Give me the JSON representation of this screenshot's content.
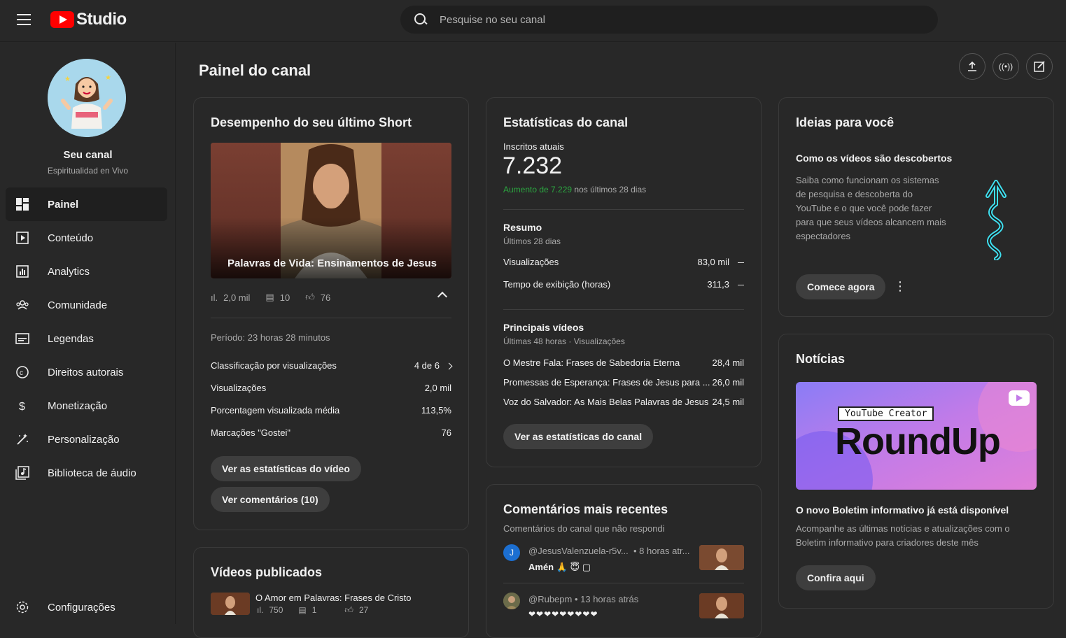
{
  "app": {
    "logo_text": "Studio"
  },
  "search": {
    "placeholder": "Pesquise no seu canal"
  },
  "sidebar": {
    "channel_label": "Seu canal",
    "channel_name": "Espiritualidad en Vivo",
    "items": [
      {
        "label": "Painel",
        "icon": "dashboard-icon",
        "active": true
      },
      {
        "label": "Conteúdo",
        "icon": "content-icon"
      },
      {
        "label": "Analytics",
        "icon": "analytics-icon"
      },
      {
        "label": "Comunidade",
        "icon": "community-icon"
      },
      {
        "label": "Legendas",
        "icon": "subtitles-icon"
      },
      {
        "label": "Direitos autorais",
        "icon": "copyright-icon"
      },
      {
        "label": "Monetização",
        "icon": "dollar-icon"
      },
      {
        "label": "Personalização",
        "icon": "magic-wand-icon"
      },
      {
        "label": "Biblioteca de áudio",
        "icon": "audio-library-icon"
      }
    ],
    "settings": "Configurações"
  },
  "main": {
    "title": "Painel do canal"
  },
  "short_card": {
    "title": "Desempenho do seu último Short",
    "thumb_title": "Palavras de Vida: Ensinamentos de Jesus",
    "views": "2,0 mil",
    "comments": "10",
    "likes": "76",
    "period": "Período: 23 horas 28 minutos",
    "rows": [
      {
        "label": "Classificação por visualizações",
        "value": "4 de 6"
      },
      {
        "label": "Visualizações",
        "value": "2,0 mil"
      },
      {
        "label": "Porcentagem visualizada média",
        "value": "113,5%"
      },
      {
        "label": "Marcações \"Gostei\"",
        "value": "76"
      }
    ],
    "btn_stats": "Ver as estatísticas do vídeo",
    "btn_comments": "Ver comentários (10)"
  },
  "published_card": {
    "title": "Vídeos publicados",
    "video_title": "O Amor em Palavras: Frases de Cristo",
    "views": "750",
    "comments": "1",
    "likes": "27"
  },
  "stats_card": {
    "title": "Estatísticas do canal",
    "subs_label": "Inscritos atuais",
    "subs_value": "7.232",
    "growth_highlight": "Aumento de 7.229",
    "growth_rest": " nos últimos 28 dias",
    "summary_title": "Resumo",
    "summary_period": "Últimos 28 dias",
    "summary_rows": [
      {
        "label": "Visualizações",
        "value": "83,0 mil"
      },
      {
        "label": "Tempo de exibição (horas)",
        "value": "311,3"
      }
    ],
    "top_title": "Principais vídeos",
    "top_period": "Últimas 48 horas · Visualizações",
    "top_rows": [
      {
        "label": "O Mestre Fala: Frases de Sabedoria Eterna",
        "value": "28,4 mil"
      },
      {
        "label": "Promessas de Esperança: Frases de Jesus para ...",
        "value": "26,0 mil"
      },
      {
        "label": "Voz do Salvador: As Mais Belas Palavras de Jesus",
        "value": "24,5 mil"
      }
    ],
    "btn": "Ver as estatísticas do canal"
  },
  "comments_card": {
    "title": "Comentários mais recentes",
    "subtitle": "Comentários do canal que não respondi",
    "comments": [
      {
        "avatar": "J",
        "user": "@JesusValenzuela-r5v...",
        "time": "• 8 horas atr...",
        "text": "Amén 🙏 😇 ▢"
      },
      {
        "avatar": "",
        "user": "@Rubepm",
        "time": "• 13 horas atrás",
        "text": "❤❤❤❤❤❤❤❤❤"
      }
    ]
  },
  "ideas_card": {
    "title": "Ideias para você",
    "subtitle": "Como os vídeos são descobertos",
    "body": "Saiba como funcionam os sistemas de pesquisa e descoberta do YouTube e o que você pode fazer para que seus vídeos alcancem mais espectadores",
    "btn": "Comece agora"
  },
  "news_card": {
    "title": "Notícias",
    "banner_tag": "YouTube Creator",
    "banner_title": "RoundUp",
    "headline": "O novo Boletim informativo já está disponível",
    "body": "Acompanhe as últimas notícias e atualizações com o Boletim informativo para criadores deste mês",
    "btn": "Confira aqui"
  },
  "colors": {
    "accent_green": "#2ba640",
    "brand_red": "#ff0000"
  }
}
